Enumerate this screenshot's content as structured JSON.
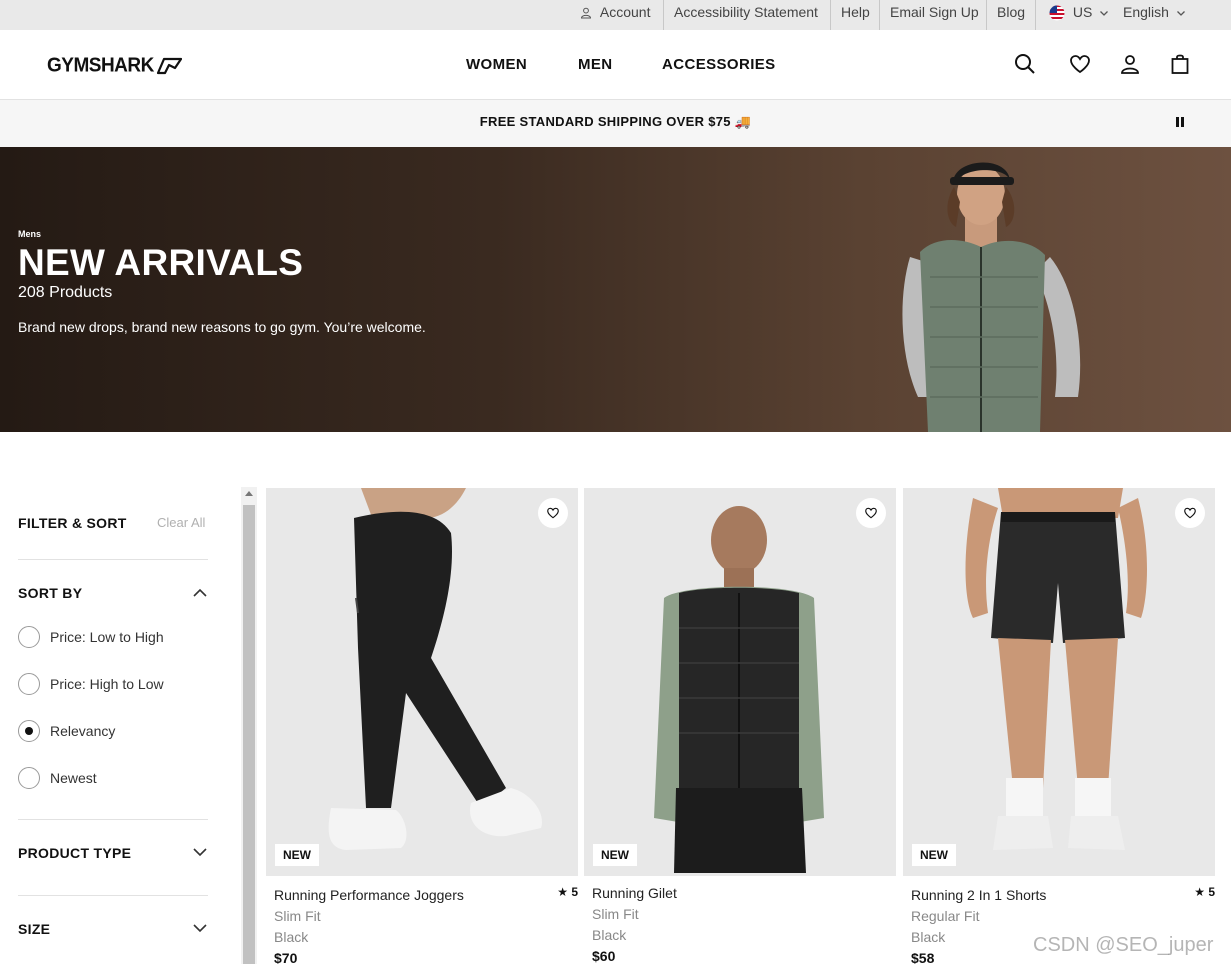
{
  "utility_bar": {
    "account": "Account",
    "accessibility": "Accessibility Statement",
    "help": "Help",
    "email_signup": "Email Sign Up",
    "blog": "Blog",
    "region": "US",
    "language": "English"
  },
  "header": {
    "logo": "GYMSHARK",
    "nav": [
      "WOMEN",
      "MEN",
      "ACCESSORIES"
    ]
  },
  "banner": {
    "text": "FREE STANDARD SHIPPING OVER $75 🚚"
  },
  "hero": {
    "eyebrow": "Mens",
    "title": "NEW ARRIVALS",
    "count": "208 Products",
    "description": "Brand new drops, brand new reasons to go gym. You’re welcome."
  },
  "filters": {
    "title": "FILTER & SORT",
    "clear_all": "Clear All",
    "sort_by": "SORT BY",
    "sort_options": [
      {
        "label": "Price: Low to High",
        "selected": false
      },
      {
        "label": "Price: High to Low",
        "selected": false
      },
      {
        "label": "Relevancy",
        "selected": true
      },
      {
        "label": "Newest",
        "selected": false
      }
    ],
    "product_type": "PRODUCT TYPE",
    "size": "SIZE"
  },
  "products": [
    {
      "badge": "NEW",
      "name": "Running Performance Joggers",
      "rating": "★ 5",
      "fit": "Slim Fit",
      "color": "Black",
      "price": "$70"
    },
    {
      "badge": "NEW",
      "name": "Running Gilet",
      "rating": "",
      "fit": "Slim Fit",
      "color": "Black",
      "price": "$60"
    },
    {
      "badge": "NEW",
      "name": "Running 2 In 1 Shorts",
      "rating": "★ 5",
      "fit": "Regular Fit",
      "color": "Black",
      "price": "$58"
    }
  ],
  "watermark": "CSDN @SEO_juper",
  "colors": {
    "hero_dark": "#241a14",
    "hero_light": "#6d5140",
    "card_bg": "#e8e8e8",
    "vest_green": "#6f8070"
  }
}
